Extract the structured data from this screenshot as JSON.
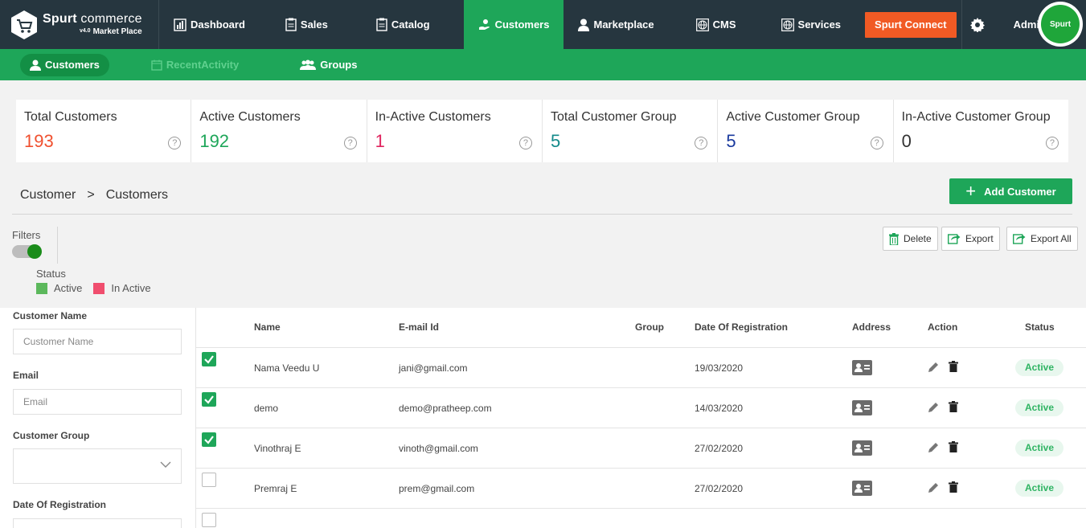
{
  "brand": {
    "name_bold": "Spurt",
    "name_light": " commerce",
    "version": "v4.0",
    "subtitle": "Market Place"
  },
  "nav": {
    "items": [
      {
        "label": "Dashboard",
        "icon": "chart-icon"
      },
      {
        "label": "Sales",
        "icon": "clipboard-icon"
      },
      {
        "label": "Catalog",
        "icon": "clipboard-icon"
      },
      {
        "label": "Customers",
        "icon": "customer-hand-icon"
      },
      {
        "label": "Marketplace",
        "icon": "user-icon"
      },
      {
        "label": "CMS",
        "icon": "globe-icon"
      },
      {
        "label": "Services",
        "icon": "globe-icon"
      }
    ],
    "connect_label": "Spurt Connect",
    "admin_label": "Admin",
    "avatar_text": "Spurt"
  },
  "subnav": {
    "items": [
      {
        "label": "Customers"
      },
      {
        "label": "RecentActivity"
      },
      {
        "label": "Groups"
      }
    ]
  },
  "stats": [
    {
      "label": "Total Customers",
      "value": "193",
      "color": "#f0502f"
    },
    {
      "label": "Active Customers",
      "value": "192",
      "color": "#1ea659"
    },
    {
      "label": "In-Active Customers",
      "value": "1",
      "color": "#e0245e"
    },
    {
      "label": "Total Customer Group",
      "value": "5",
      "color": "#138a8a"
    },
    {
      "label": "Active Customer Group",
      "value": "5",
      "color": "#1a3a9e"
    },
    {
      "label": "In-Active Customer Group",
      "value": "0",
      "color": "#333333"
    }
  ],
  "breadcrumb": {
    "parent": "Customer",
    "sep": ">",
    "current": "Customers"
  },
  "add_button": "Add Customer",
  "filters": {
    "label": "Filters",
    "status_label": "Status",
    "legend_active": "Active",
    "legend_inactive": "In Active"
  },
  "toolbar": {
    "delete": "Delete",
    "export": "Export",
    "export_all": "Export All"
  },
  "filter_panel": {
    "customer_name_label": "Customer Name",
    "customer_name_placeholder": "Customer Name",
    "email_label": "Email",
    "email_placeholder": "Email",
    "group_label": "Customer Group",
    "date_label": "Date Of Registration"
  },
  "table": {
    "headers": {
      "name": "Name",
      "email": "E-mail Id",
      "group": "Group",
      "date": "Date Of Registration",
      "address": "Address",
      "action": "Action",
      "status": "Status"
    },
    "rows": [
      {
        "checked": true,
        "name": "Nama Veedu U",
        "email": "jani@gmail.com",
        "group": "",
        "date": "19/03/2020",
        "status": "Active"
      },
      {
        "checked": true,
        "name": "demo",
        "email": "demo@pratheep.com",
        "group": "",
        "date": "14/03/2020",
        "status": "Active"
      },
      {
        "checked": true,
        "name": "Vinothraj E",
        "email": "vinoth@gmail.com",
        "group": "",
        "date": "27/02/2020",
        "status": "Active"
      },
      {
        "checked": false,
        "name": "Premraj E",
        "email": "prem@gmail.com",
        "group": "",
        "date": "27/02/2020",
        "status": "Active"
      }
    ]
  }
}
